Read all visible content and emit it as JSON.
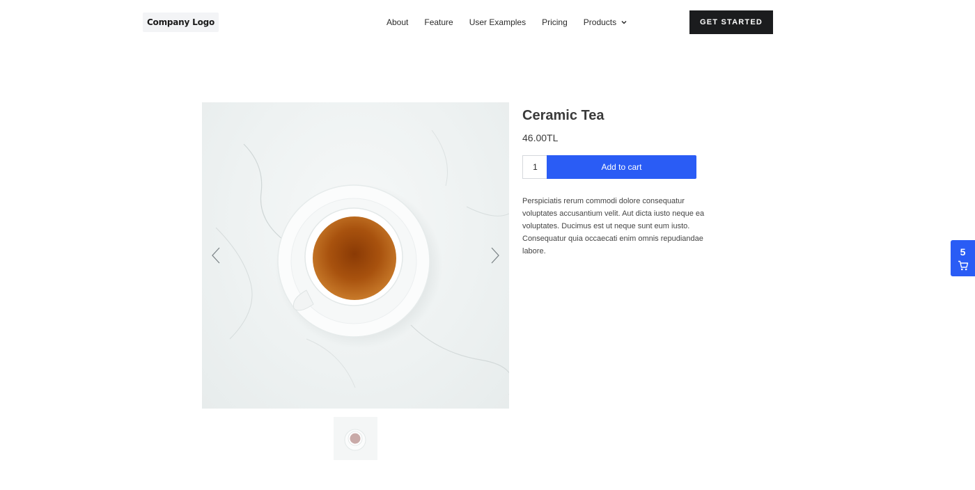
{
  "header": {
    "logo_text": "Company Logo",
    "nav": [
      {
        "label": "About"
      },
      {
        "label": "Feature"
      },
      {
        "label": "User Examples"
      },
      {
        "label": "Pricing"
      },
      {
        "label": "Products"
      }
    ],
    "cta_label": "GET STARTED"
  },
  "product": {
    "title": "Ceramic Tea",
    "price": "46.00TL",
    "quantity": "1",
    "add_to_cart_label": "Add to cart",
    "description": "Perspiciatis rerum commodi dolore consequatur voluptates accusantium velit. Aut dicta iusto neque ea voluptates. Ducimus est ut neque sunt eum iusto. Consequatur quia occaecati enim omnis repudiandae labore."
  },
  "cart": {
    "count": "5",
    "icon": "cart-icon"
  },
  "colors": {
    "accent": "#2a5cf5",
    "cta_bg": "#1b1c1e"
  }
}
